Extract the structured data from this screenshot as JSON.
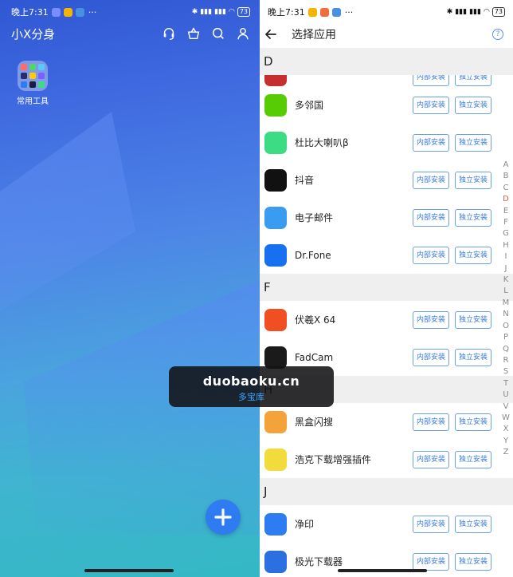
{
  "left": {
    "status": {
      "time": "晚上7:31",
      "dots": "···",
      "battery": "73"
    },
    "header": {
      "title": "小X分身"
    },
    "folder": {
      "label": "常用工具"
    },
    "icons": [
      "headset-icon",
      "basket-icon",
      "search-icon",
      "user-icon"
    ],
    "fab_label": "+"
  },
  "right": {
    "status": {
      "time": "晚上7:31",
      "dots": "···",
      "battery": "73"
    },
    "header": {
      "title": "选择应用",
      "help": "?"
    },
    "buttons": {
      "inner": "内部安装",
      "independent": "独立安装"
    },
    "sections": [
      {
        "letter": "D",
        "apps": [
          {
            "name": "",
            "partial": true,
            "icon_color": "#c62f2f"
          },
          {
            "name": "多邻国",
            "icon_color": "#58cc02"
          },
          {
            "name": "杜比大喇叭β",
            "icon_color": "#3ddc84"
          },
          {
            "name": "抖音",
            "icon_color": "#111111"
          },
          {
            "name": "电子邮件",
            "icon_color": "#3a9cf0"
          },
          {
            "name": "Dr.Fone",
            "icon_color": "#1670f0"
          }
        ]
      },
      {
        "letter": "F",
        "apps": [
          {
            "name": "伏羲X 64",
            "icon_color": "#f04e23"
          },
          {
            "name": "FadCam",
            "icon_color": "#1a1a1a"
          }
        ]
      },
      {
        "letter": "H",
        "apps": [
          {
            "name": "黑盒闪搜",
            "icon_color": "#f3a33a"
          },
          {
            "name": "浩克下载增强插件",
            "icon_color": "#f2dc3c"
          }
        ]
      },
      {
        "letter": "J",
        "apps": [
          {
            "name": "净印",
            "icon_color": "#2d7cf2"
          },
          {
            "name": "极光下载器",
            "icon_color": "#2b6fe0"
          }
        ]
      }
    ],
    "alphabet": [
      "A",
      "B",
      "C",
      "D",
      "E",
      "F",
      "G",
      "H",
      "I",
      "J",
      "K",
      "L",
      "M",
      "N",
      "O",
      "P",
      "Q",
      "R",
      "S",
      "T",
      "U",
      "V",
      "W",
      "X",
      "Y",
      "Z"
    ],
    "active_letter": "D"
  },
  "watermark": {
    "domain": "duobaoku.cn",
    "name": "多宝库"
  }
}
